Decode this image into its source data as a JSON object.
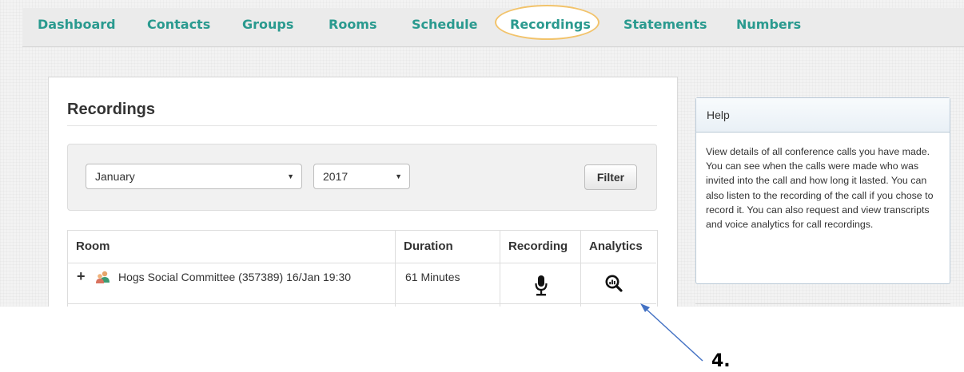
{
  "nav": {
    "items": [
      {
        "label": "Dashboard"
      },
      {
        "label": "Contacts"
      },
      {
        "label": "Groups"
      },
      {
        "label": "Rooms"
      },
      {
        "label": "Schedule"
      },
      {
        "label": "Recordings",
        "active": true
      },
      {
        "label": "Statements"
      },
      {
        "label": "Numbers"
      }
    ]
  },
  "page": {
    "title": "Recordings"
  },
  "filter": {
    "month": "January",
    "year": "2017",
    "button_label": "Filter"
  },
  "table": {
    "headers": [
      "Room",
      "Duration",
      "Recording",
      "Analytics"
    ],
    "rows": [
      {
        "expand": "+",
        "room": "Hogs Social Committee (357389) 16/Jan 19:30",
        "duration": "61 Minutes",
        "recording_icon": "microphone-icon",
        "analytics_icon": "magnifier-chart-icon"
      }
    ]
  },
  "help": {
    "title": "Help",
    "body": "View details of all conference calls you have made. You can see when the calls were made who was invited into the call and how long it lasted. You can also listen to the recording of the call if you chose to record it. You can also request and view transcripts and voice analytics for call recordings."
  },
  "annotation": {
    "step_label": "4.",
    "arrow_color": "#4472c4",
    "highlight_color": "#f2c36b"
  },
  "colors": {
    "nav_text": "#2a9a8f",
    "text": "#333333"
  }
}
